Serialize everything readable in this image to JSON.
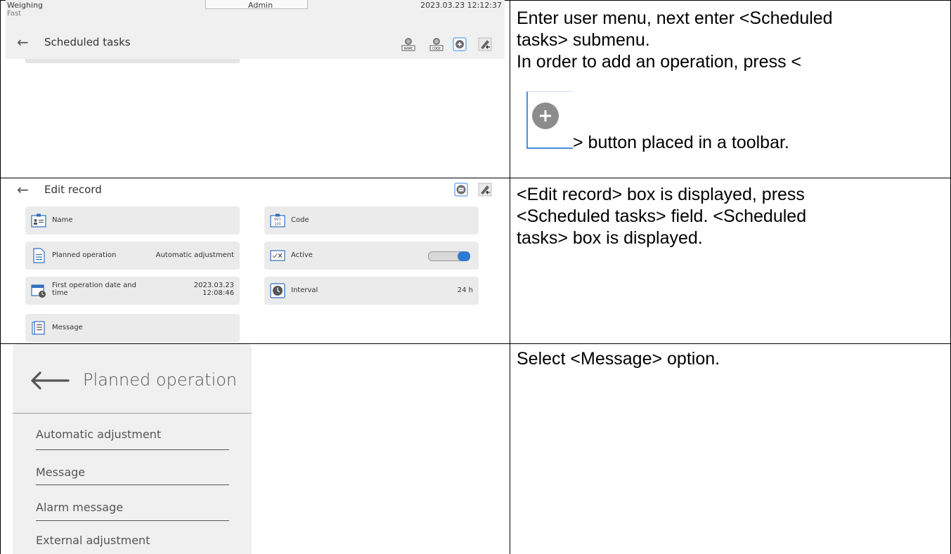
{
  "row1": {
    "status_bar": {
      "mode": "Weighing",
      "sub_mode": "Fast",
      "user": "Admin",
      "datetime": "2023.03.23 12:12:37"
    },
    "header": {
      "title": "Scheduled tasks",
      "tools": [
        "name-search-icon",
        "code-search-icon",
        "add-icon",
        "edit-icon"
      ],
      "tool_labels": {
        "name": "NAME",
        "code": "CODE"
      }
    },
    "instruction": {
      "line1": "Enter user menu, next enter <Scheduled",
      "line2": "tasks> submenu.",
      "line3": "In order to add an operation, press  <",
      "line4": "> button placed in a toolbar."
    }
  },
  "row2": {
    "header": {
      "title": "Edit record",
      "tools": [
        "print-icon",
        "edit-icon"
      ]
    },
    "fields": {
      "name": {
        "label": "Name",
        "value": ""
      },
      "code": {
        "label": "Code",
        "value": ""
      },
      "planned_operation": {
        "label": "Planned operation",
        "value": "Automatic adjustment"
      },
      "active": {
        "label": "Active",
        "enabled": true
      },
      "first_operation": {
        "label_line1": "First operation date and",
        "label_line2": "time",
        "date": "2023.03.23",
        "time": "12:08:46"
      },
      "interval": {
        "label": "Interval",
        "value": "24 h"
      },
      "message": {
        "label": "Message"
      }
    },
    "code_icon_text": {
      "top": "001",
      "bottom": "100"
    },
    "instruction": {
      "line1": "<Edit record> box is displayed, press",
      "line2": "<Scheduled tasks> field. <Scheduled",
      "line3": "tasks> box is displayed."
    }
  },
  "row3": {
    "header": {
      "title": "Planned operation"
    },
    "options": [
      "Automatic adjustment",
      "Message",
      "Alarm message",
      "External adjustment"
    ],
    "instruction": {
      "line1": "Select <Message> option."
    }
  },
  "colors": {
    "toggle_on": "#2e7bd6",
    "focus_border": "#4a8ee0",
    "panel_bg": "#f0f0f0",
    "field_bg": "#ebebeb"
  }
}
